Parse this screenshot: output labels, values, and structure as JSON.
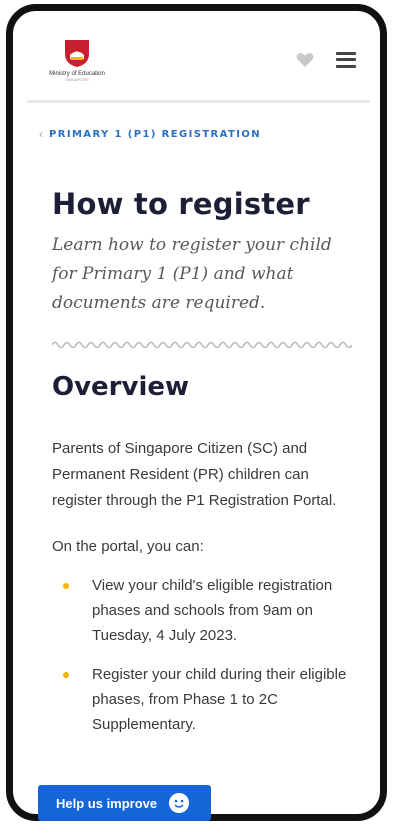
{
  "header": {
    "logo_text": "Ministry of Education",
    "logo_subtext": "SINGAPORE",
    "icons": {
      "favourite": "heart-icon",
      "menu": "menu-icon"
    }
  },
  "breadcrumb": {
    "label": "PRIMARY 1 (P1) REGISTRATION"
  },
  "page": {
    "title": "How to register",
    "subtitle": "Learn how to register your child for Primary 1 (P1) and what documents are required."
  },
  "overview": {
    "heading": "Overview",
    "intro": "Parents of Singapore Citizen (SC) and Permanent Resident (PR) children can register through the P1 Registration Portal.",
    "portal_lead": "On the portal, you can:",
    "items": [
      "View your child's eligible registration phases and schools from 9am on Tuesday, 4 July 2023.",
      "Register your child during their eligible phases, from Phase 1 to 2C Supplementary."
    ]
  },
  "feedback": {
    "label": "Help us improve"
  },
  "colors": {
    "accent": "#1565d8",
    "bullet": "#f2b705",
    "heading": "#1c1f36",
    "crest": "#c8202f"
  }
}
